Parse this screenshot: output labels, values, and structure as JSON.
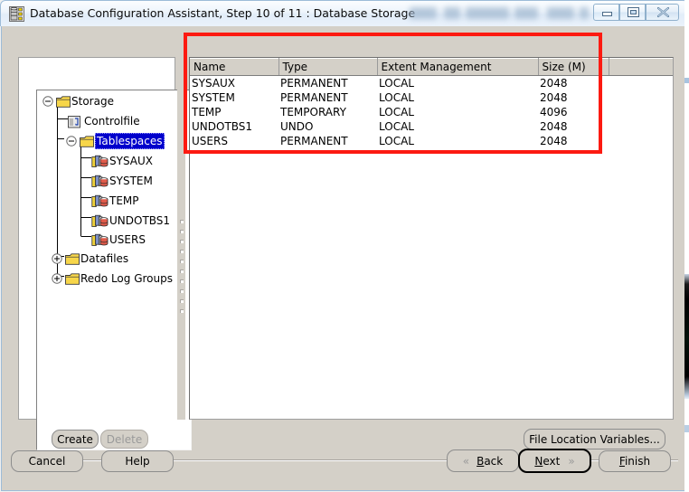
{
  "window": {
    "title": "Database Configuration Assistant, Step 10 of 11 : Database Storage",
    "app_icon": "database-icon",
    "controls": {
      "minimize": "minimize-icon",
      "maximize": "maximize-icon",
      "close": "close-icon"
    }
  },
  "tree": {
    "nodes": [
      {
        "label": "Storage",
        "level": 0,
        "icon": "folder-icon",
        "expanded": true,
        "selected": false
      },
      {
        "label": "Controlfile",
        "level": 1,
        "icon": "controlfile-icon",
        "expanded": null,
        "selected": false
      },
      {
        "label": "Tablespaces",
        "level": 1,
        "icon": "folder-icon",
        "expanded": true,
        "selected": true
      },
      {
        "label": "SYSAUX",
        "level": 2,
        "icon": "tablespace-icon",
        "expanded": null,
        "selected": false
      },
      {
        "label": "SYSTEM",
        "level": 2,
        "icon": "tablespace-icon",
        "expanded": null,
        "selected": false
      },
      {
        "label": "TEMP",
        "level": 2,
        "icon": "tablespace-icon",
        "expanded": null,
        "selected": false
      },
      {
        "label": "UNDOTBS1",
        "level": 2,
        "icon": "tablespace-icon",
        "expanded": null,
        "selected": false
      },
      {
        "label": "USERS",
        "level": 2,
        "icon": "tablespace-icon",
        "expanded": null,
        "selected": false
      },
      {
        "label": "Datafiles",
        "level": 1,
        "icon": "folder-icon",
        "expanded": false,
        "selected": false
      },
      {
        "label": "Redo Log Groups",
        "level": 1,
        "icon": "folder-icon",
        "expanded": false,
        "selected": false
      }
    ]
  },
  "table": {
    "columns": [
      "Name",
      "Type",
      "Extent Management",
      "Size (M)"
    ],
    "rows": [
      {
        "name": "SYSAUX",
        "type": "PERMANENT",
        "extent_management": "LOCAL",
        "size_m": "2048"
      },
      {
        "name": "SYSTEM",
        "type": "PERMANENT",
        "extent_management": "LOCAL",
        "size_m": "2048"
      },
      {
        "name": "TEMP",
        "type": "TEMPORARY",
        "extent_management": "LOCAL",
        "size_m": "4096"
      },
      {
        "name": "UNDOTBS1",
        "type": "UNDO",
        "extent_management": "LOCAL",
        "size_m": "2048"
      },
      {
        "name": "USERS",
        "type": "PERMANENT",
        "extent_management": "LOCAL",
        "size_m": "2048"
      }
    ]
  },
  "annotation": {
    "highlight_color": "#fc1a11",
    "target": "tablespaces-table"
  },
  "actions": {
    "create": "Create",
    "delete": "Delete",
    "file_location_variables": "File Location Variables..."
  },
  "navigation": {
    "cancel": "Cancel",
    "help": "Help",
    "back": "Back",
    "back_mnemonic": "B",
    "next": "Next",
    "next_mnemonic": "N",
    "finish": "Finish",
    "finish_mnemonic": "F",
    "back_arrow": "«",
    "next_arrow": "»"
  }
}
